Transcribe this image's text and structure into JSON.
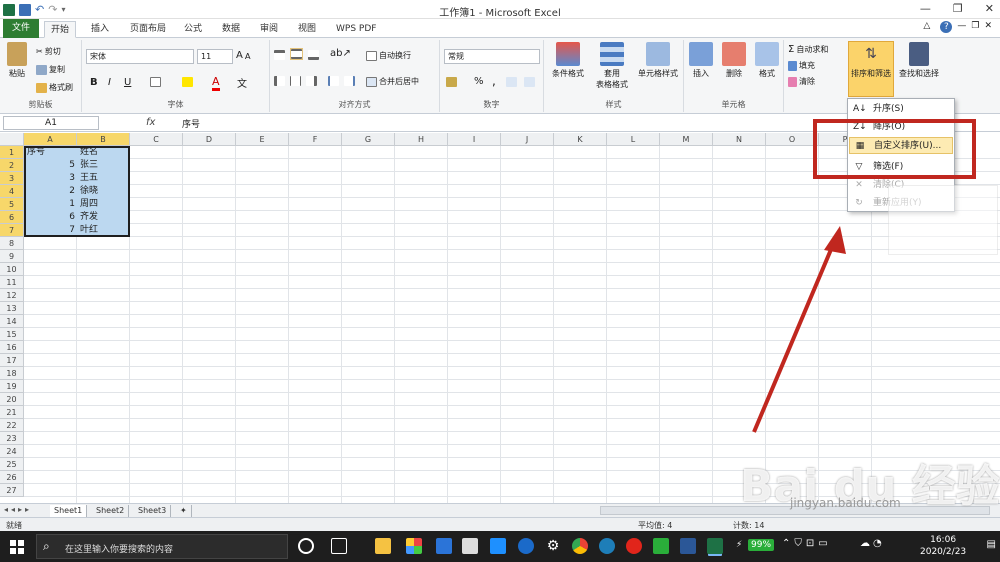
{
  "window": {
    "title": "工作簿1 - Microsoft Excel"
  },
  "tabs": [
    "文件",
    "开始",
    "插入",
    "页面布局",
    "公式",
    "数据",
    "审阅",
    "视图",
    "WPS PDF"
  ],
  "ribbon": {
    "clipboard": {
      "paste": "粘贴",
      "cut": "剪切",
      "copy": "复制",
      "format_painter": "格式刷",
      "label": "剪贴板"
    },
    "font": {
      "name": "宋体",
      "size": "11",
      "label": "字体",
      "bold": "B",
      "italic": "I",
      "underline": "U"
    },
    "alignment": {
      "wrap": "自动换行",
      "merge": "合并后居中",
      "label": "对齐方式"
    },
    "number": {
      "format": "常规",
      "label": "数字",
      "percent": "%",
      "comma": ","
    },
    "styles": {
      "conditional": "条件格式",
      "table1": "套用",
      "table2": "表格格式",
      "cell_styles": "单元格样式",
      "label": "样式"
    },
    "cells": {
      "insert": "插入",
      "delete": "删除",
      "format": "格式",
      "label": "单元格"
    },
    "editing": {
      "autosum": "自动求和",
      "fill": "填充",
      "clear": "清除",
      "sort_filter": "排序和筛选",
      "find_select": "查找和选择"
    }
  },
  "formula_bar": {
    "name_box": "A1",
    "fx": "fx",
    "value": "序号"
  },
  "columns": [
    "A",
    "B",
    "C",
    "D",
    "E",
    "F",
    "G",
    "H",
    "I",
    "J",
    "K",
    "L",
    "M",
    "N",
    "O",
    "P"
  ],
  "rows": [
    "1",
    "2",
    "3",
    "4",
    "5",
    "6",
    "7",
    "8",
    "9",
    "10",
    "11",
    "12",
    "13",
    "14",
    "15",
    "16",
    "17",
    "18",
    "19",
    "20",
    "21",
    "22",
    "23",
    "24",
    "25",
    "26",
    "27"
  ],
  "cells": {
    "header": {
      "a": "序号",
      "b": "姓名"
    },
    "data": [
      {
        "a": "5",
        "b": "张三"
      },
      {
        "a": "3",
        "b": "王五"
      },
      {
        "a": "2",
        "b": "徐晓"
      },
      {
        "a": "1",
        "b": "周四"
      },
      {
        "a": "6",
        "b": "齐发"
      },
      {
        "a": "7",
        "b": "叶红"
      }
    ]
  },
  "sort_menu": {
    "items": [
      {
        "label": "升序(S)",
        "icon": "sort-ascending-icon",
        "state": "normal"
      },
      {
        "label": "降序(O)",
        "icon": "sort-descending-icon",
        "state": "normal"
      },
      {
        "label": "自定义排序(U)...",
        "icon": "custom-sort-icon",
        "state": "highlighted"
      },
      {
        "label": "筛选(F)",
        "icon": "filter-icon",
        "state": "normal"
      },
      {
        "label": "清除(C)",
        "icon": "clear-filter-icon",
        "state": "disabled"
      },
      {
        "label": "重新应用(Y)",
        "icon": "reapply-icon",
        "state": "disabled"
      }
    ]
  },
  "sheet_tabs": [
    "Sheet1",
    "Sheet2",
    "Sheet3"
  ],
  "status": {
    "ready": "就绪",
    "average": "平均值: 4",
    "count": "计数: 14"
  },
  "taskbar": {
    "search_placeholder": "在这里输入你要搜索的内容",
    "battery": "99%",
    "time": "16:06",
    "date": "2020/2/23"
  },
  "watermark": {
    "text": "Bai du 经验",
    "url": "jingyan.baidu.com"
  },
  "colors": {
    "file_tab": "#2e7d32",
    "selection": "#bcd8f0",
    "menu_highlight": "#fdebb3",
    "annotation_red": "#c0271f"
  }
}
